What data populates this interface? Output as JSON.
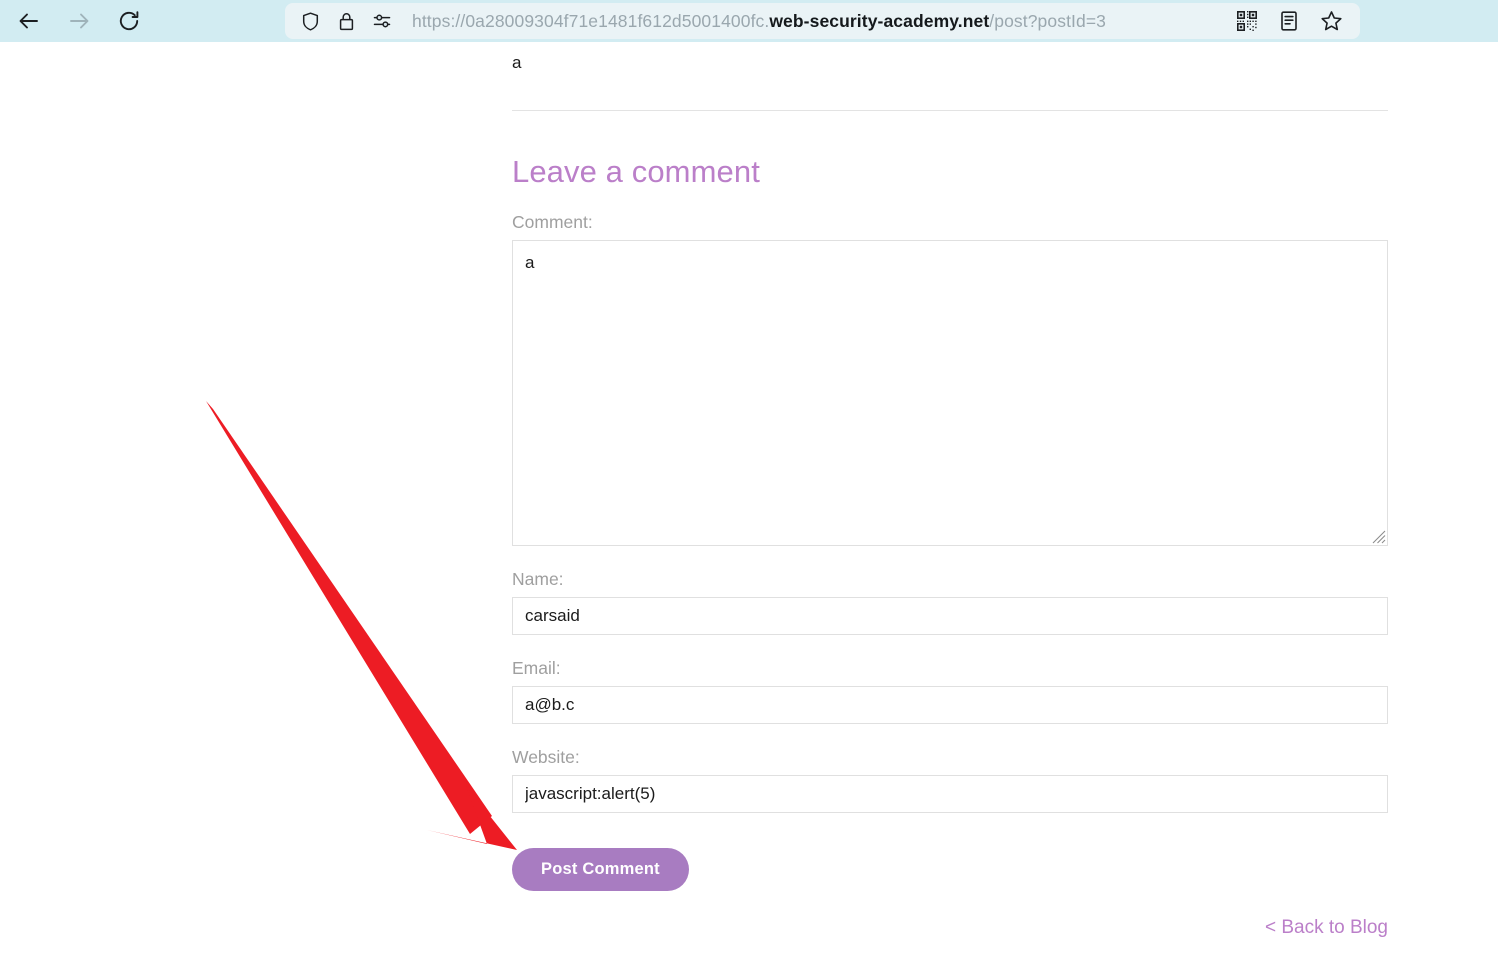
{
  "browser": {
    "nav": {
      "back_label": "Back",
      "back_icon": "arrow-left-icon",
      "back_enabled": true,
      "forward_label": "Forward",
      "forward_icon": "arrow-right-icon",
      "forward_enabled": false,
      "reload_label": "Reload",
      "reload_icon": "reload-icon"
    },
    "urlbar": {
      "shield_icon": "shield-icon",
      "lock_icon": "padlock-icon",
      "permissions_icon": "site-permissions-icon",
      "url_prefix": "https://0a28009304f71e1481f612d5001400fc.",
      "url_host": "web-security-academy.net",
      "url_suffix": "/post?postId=3",
      "url_full": "https://0a28009304f71e1481f612d5001400fc.web-security-academy.net/post?postId=3"
    },
    "tools": {
      "qr_icon": "qr-code-icon",
      "reader_icon": "reader-view-icon",
      "bookmark_icon": "bookmark-star-icon"
    },
    "colors": {
      "toolbar_bg": "#d2ecf2",
      "urlbar_bg": "#eaf3f6",
      "url_dim": "#9aa7ae",
      "url_host": "#15191c"
    }
  },
  "page": {
    "previous_comment": "a",
    "section_title": "Leave a comment",
    "fields": {
      "comment_label": "Comment:",
      "comment_value": "a",
      "comment_placeholder": "",
      "name_label": "Name:",
      "name_value": "carsaid",
      "name_placeholder": "",
      "email_label": "Email:",
      "email_value": "a@b.c",
      "email_placeholder": "",
      "website_label": "Website:",
      "website_value": "javascript:alert(5)",
      "website_placeholder": ""
    },
    "submit_label": "Post Comment",
    "back_link_label": "< Back to Blog",
    "colors": {
      "accent_purple": "#bb7fc9",
      "button_purple": "#a87cc1",
      "label_grey": "#9f9f9f",
      "border_grey": "#e0e0e0",
      "text_dark": "#1b1b1b"
    }
  },
  "annotation": {
    "arrow_color": "#ed1c24",
    "arrow_name": "red-pointer-arrow",
    "points_at": "Post Comment"
  }
}
